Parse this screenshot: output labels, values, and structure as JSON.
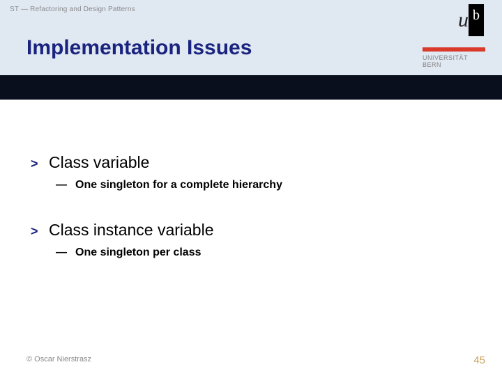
{
  "breadcrumb": "ST — Refactoring and Design Patterns",
  "title": "Implementation Issues",
  "logo": {
    "u": "u",
    "b": "b",
    "uni_line1": "UNIVERSITÄT",
    "uni_line2": "BERN"
  },
  "items": [
    {
      "bullet": ">",
      "title": "Class variable",
      "sub_dash": "—",
      "sub_text": "One singleton for a complete hierarchy"
    },
    {
      "bullet": ">",
      "title": "Class instance variable",
      "sub_dash": "—",
      "sub_text": "One singleton per class"
    }
  ],
  "footer": {
    "left": "© Oscar Nierstrasz",
    "page": "45"
  }
}
